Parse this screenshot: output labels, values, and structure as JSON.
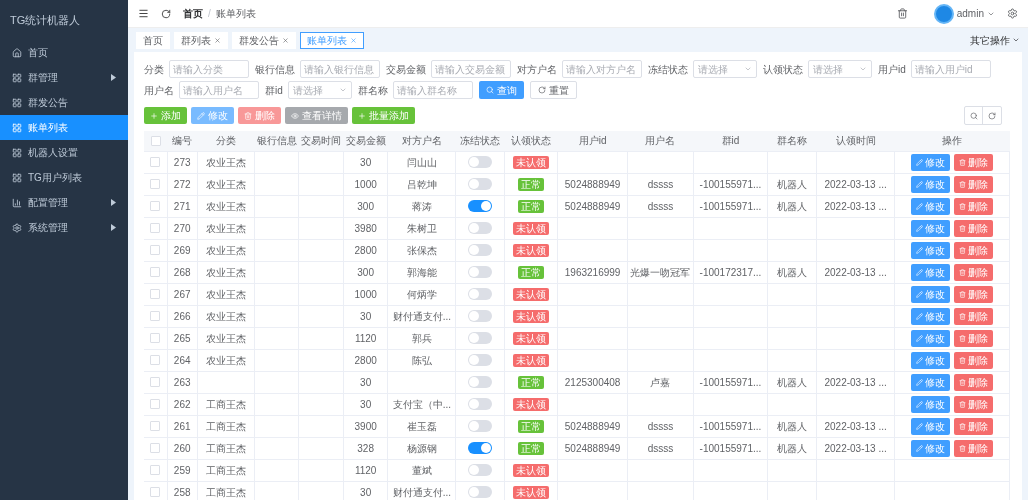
{
  "sidebar": {
    "title": "TG统计机器人",
    "items": [
      {
        "label": "首页",
        "selected": false,
        "expandable": false
      },
      {
        "label": "群管理",
        "selected": false,
        "expandable": true
      },
      {
        "label": "群发公告",
        "selected": false,
        "expandable": false
      },
      {
        "label": "账单列表",
        "selected": true,
        "expandable": false
      },
      {
        "label": "机器人设置",
        "selected": false,
        "expandable": false
      },
      {
        "label": "TG用户列表",
        "selected": false,
        "expandable": false
      },
      {
        "label": "配置管理",
        "selected": false,
        "expandable": true
      },
      {
        "label": "系统管理",
        "selected": false,
        "expandable": true
      }
    ]
  },
  "header": {
    "breadcrumb": [
      "首页",
      "账单列表"
    ],
    "breadcrumb_separator": "/",
    "user": "admin"
  },
  "tabs": [
    {
      "label": "首页",
      "selected": false,
      "closable": false
    },
    {
      "label": "群列表",
      "selected": false,
      "closable": true
    },
    {
      "label": "群发公告",
      "selected": false,
      "closable": true
    },
    {
      "label": "账单列表",
      "selected": true,
      "closable": true
    }
  ],
  "other_actions": "其它操作",
  "filters": [
    {
      "label": "分类",
      "placeholder": "请输入分类",
      "kind": "input"
    },
    {
      "label": "银行信息",
      "placeholder": "请输入银行信息",
      "kind": "input"
    },
    {
      "label": "交易金额",
      "placeholder": "请输入交易金额",
      "kind": "input"
    },
    {
      "label": "对方户名",
      "placeholder": "请输入对方户名",
      "kind": "input"
    },
    {
      "label": "冻结状态",
      "placeholder": "请选择",
      "kind": "select"
    },
    {
      "label": "认领状态",
      "placeholder": "请选择",
      "kind": "select"
    },
    {
      "label": "用户id",
      "placeholder": "请输入用户id",
      "kind": "input"
    },
    {
      "label": "用户名",
      "placeholder": "请输入用户名",
      "kind": "input"
    },
    {
      "label": "群id",
      "placeholder": "请选择",
      "kind": "select"
    },
    {
      "label": "群名称",
      "placeholder": "请输入群名称",
      "kind": "input"
    }
  ],
  "search_buttons": [
    {
      "label": "查询",
      "kind": "search"
    },
    {
      "label": "重置",
      "kind": "reset"
    }
  ],
  "toolbar": [
    {
      "label": "添加",
      "kind": "add",
      "disabled": false
    },
    {
      "label": "修改",
      "kind": "edit",
      "disabled": true
    },
    {
      "label": "删除",
      "kind": "delete",
      "disabled": true
    },
    {
      "label": "查看详情",
      "kind": "view",
      "disabled": true
    },
    {
      "label": "批量添加",
      "kind": "add",
      "disabled": false
    }
  ],
  "table": {
    "all_checked": false,
    "columns": [
      "编号",
      "分类",
      "银行信息",
      "交易时间",
      "交易金额",
      "对方户名",
      "冻结状态",
      "认领状态",
      "用户id",
      "用户名",
      "群id",
      "群名称",
      "认领时间",
      "操作"
    ],
    "rows": [
      {
        "checked": false,
        "id": "273",
        "category": "农业王杰",
        "amount": "30",
        "payee": "闫山山",
        "frozen": false,
        "status": "未认领",
        "claimed": false,
        "user_id": "",
        "user_name": "",
        "group_id": "",
        "group_name": "",
        "claim_time": "",
        "actions": [
          "修改",
          "删除"
        ]
      },
      {
        "checked": false,
        "id": "272",
        "category": "农业王杰",
        "amount": "1000",
        "payee": "吕乾坤",
        "frozen": false,
        "status": "正常",
        "claimed": true,
        "user_id": "5024888949",
        "user_name": "dssss",
        "group_id": "-100155971...",
        "group_name": "机器人",
        "claim_time": "2022-03-13 ...",
        "actions": [
          "修改",
          "删除"
        ]
      },
      {
        "checked": false,
        "id": "271",
        "category": "农业王杰",
        "amount": "300",
        "payee": "蒋涛",
        "frozen": true,
        "status": "正常",
        "claimed": true,
        "user_id": "5024888949",
        "user_name": "dssss",
        "group_id": "-100155971...",
        "group_name": "机器人",
        "claim_time": "2022-03-13 ...",
        "actions": [
          "修改",
          "删除"
        ]
      },
      {
        "checked": false,
        "id": "270",
        "category": "农业王杰",
        "amount": "3980",
        "payee": "朱树卫",
        "frozen": false,
        "status": "未认领",
        "claimed": false,
        "user_id": "",
        "user_name": "",
        "group_id": "",
        "group_name": "",
        "claim_time": "",
        "actions": [
          "修改",
          "删除"
        ]
      },
      {
        "checked": false,
        "id": "269",
        "category": "农业王杰",
        "amount": "2800",
        "payee": "张保杰",
        "frozen": false,
        "status": "未认领",
        "claimed": false,
        "user_id": "",
        "user_name": "",
        "group_id": "",
        "group_name": "",
        "claim_time": "",
        "actions": [
          "修改",
          "删除"
        ]
      },
      {
        "checked": false,
        "id": "268",
        "category": "农业王杰",
        "amount": "300",
        "payee": "郭海能",
        "frozen": false,
        "status": "正常",
        "claimed": true,
        "user_id": "1963216999",
        "user_name": "光爆一吻冠军",
        "group_id": "-100172317...",
        "group_name": "机器人",
        "claim_time": "2022-03-13 ...",
        "actions": [
          "修改",
          "删除"
        ]
      },
      {
        "checked": false,
        "id": "267",
        "category": "农业王杰",
        "amount": "1000",
        "payee": "何炳学",
        "frozen": false,
        "status": "未认领",
        "claimed": false,
        "user_id": "",
        "user_name": "",
        "group_id": "",
        "group_name": "",
        "claim_time": "",
        "actions": [
          "修改",
          "删除"
        ]
      },
      {
        "checked": false,
        "id": "266",
        "category": "农业王杰",
        "amount": "30",
        "payee": "财付通支付...",
        "frozen": false,
        "status": "未认领",
        "claimed": false,
        "user_id": "",
        "user_name": "",
        "group_id": "",
        "group_name": "",
        "claim_time": "",
        "actions": [
          "修改",
          "删除"
        ]
      },
      {
        "checked": false,
        "id": "265",
        "category": "农业王杰",
        "amount": "1120",
        "payee": "郭兵",
        "frozen": false,
        "status": "未认领",
        "claimed": false,
        "user_id": "",
        "user_name": "",
        "group_id": "",
        "group_name": "",
        "claim_time": "",
        "actions": [
          "修改",
          "删除"
        ]
      },
      {
        "checked": false,
        "id": "264",
        "category": "农业王杰",
        "amount": "2800",
        "payee": "陈弘",
        "frozen": false,
        "status": "未认领",
        "claimed": false,
        "user_id": "",
        "user_name": "",
        "group_id": "",
        "group_name": "",
        "claim_time": "",
        "actions": [
          "修改",
          "删除"
        ]
      },
      {
        "checked": false,
        "id": "263",
        "category": "",
        "amount": "30",
        "payee": "",
        "frozen": false,
        "status": "正常",
        "claimed": true,
        "user_id": "2125300408",
        "user_name": "卢嘉",
        "group_id": "-100155971...",
        "group_name": "机器人",
        "claim_time": "2022-03-13 ...",
        "actions": [
          "修改",
          "删除"
        ]
      },
      {
        "checked": false,
        "id": "262",
        "category": "工商王杰",
        "amount": "30",
        "payee": "支付宝（中...",
        "frozen": false,
        "status": "未认领",
        "claimed": false,
        "user_id": "",
        "user_name": "",
        "group_id": "",
        "group_name": "",
        "claim_time": "",
        "actions": [
          "修改",
          "删除"
        ]
      },
      {
        "checked": false,
        "id": "261",
        "category": "工商王杰",
        "amount": "3900",
        "payee": "崔玉磊",
        "frozen": false,
        "status": "正常",
        "claimed": true,
        "user_id": "5024888949",
        "user_name": "dssss",
        "group_id": "-100155971...",
        "group_name": "机器人",
        "claim_time": "2022-03-13 ...",
        "actions": [
          "修改",
          "删除"
        ]
      },
      {
        "checked": false,
        "id": "260",
        "category": "工商王杰",
        "amount": "328",
        "payee": "杨源钢",
        "frozen": true,
        "status": "正常",
        "claimed": true,
        "user_id": "5024888949",
        "user_name": "dssss",
        "group_id": "-100155971...",
        "group_name": "机器人",
        "claim_time": "2022-03-13 ...",
        "actions": [
          "修改",
          "删除"
        ]
      },
      {
        "checked": false,
        "id": "259",
        "category": "工商王杰",
        "amount": "1120",
        "payee": "董斌",
        "frozen": false,
        "status": "未认领",
        "claimed": false,
        "user_id": "",
        "user_name": "",
        "group_id": "",
        "group_name": "",
        "claim_time": "",
        "actions": []
      },
      {
        "checked": false,
        "id": "258",
        "category": "工商王杰",
        "amount": "30",
        "payee": "财付通支付...",
        "frozen": false,
        "status": "未认领",
        "claimed": false,
        "user_id": "",
        "user_name": "",
        "group_id": "",
        "group_name": "",
        "claim_time": "",
        "actions": []
      }
    ]
  }
}
